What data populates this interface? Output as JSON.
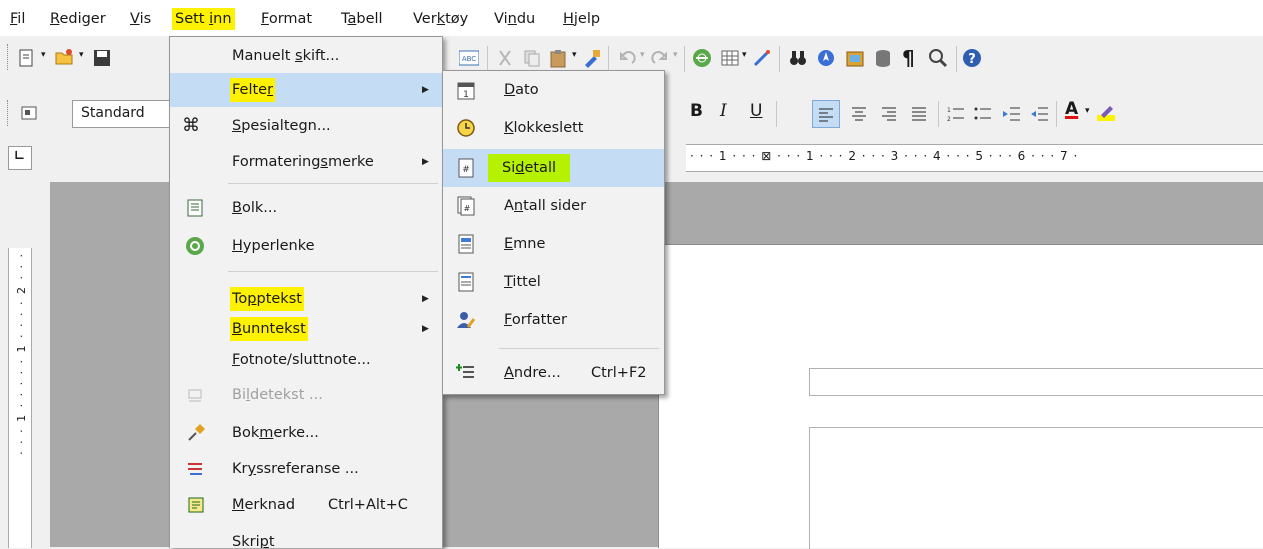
{
  "menubar": {
    "items": [
      {
        "label": "Fil",
        "mn": "F",
        "rest": "il"
      },
      {
        "label": "Rediger",
        "mn": "R",
        "rest": "ediger"
      },
      {
        "label": "Vis",
        "mn": "V",
        "rest": "is"
      },
      {
        "label": "Sett inn",
        "pre": "Sett ",
        "mn": "i",
        "rest": "nn"
      },
      {
        "label": "Format",
        "mn": "F",
        "rest": "ormat"
      },
      {
        "label": "Tabell",
        "pre": "T",
        "mn": "a",
        "rest": "bell"
      },
      {
        "label": "Verktøy",
        "pre": "Ver",
        "mn": "k",
        "rest": "tøy"
      },
      {
        "label": "Vindu",
        "pre": "Vi",
        "mn": "n",
        "rest": "du"
      },
      {
        "label": "Hjelp",
        "mn": "H",
        "rest": "jelp"
      }
    ],
    "highlight_color": "#fff200"
  },
  "formatting": {
    "paragraph_style": "Standard",
    "bold": "B",
    "italic": "I",
    "underline": "U"
  },
  "ruler": {
    "ticks": "· · · 1 · · · ⊠ · · · 1 · · · 2 · · · 3 · · · 4 · · · 5 · · · 6 · · · 7 ·",
    "vticks": "· · · 1 · · · · · 1 · · · · 2 · · ·"
  },
  "sett_inn_menu": {
    "items": [
      {
        "pre": "Manuelt ",
        "mn": "s",
        "rest": "kift..."
      },
      {
        "pre": "Felte",
        "mn": "r",
        "rest": "",
        "submenu": true,
        "hl": "yellow"
      },
      {
        "pre": "",
        "mn": "S",
        "rest": "pesialtegn...",
        "icon": "special-char-icon"
      },
      {
        "pre": "Formatering",
        "mn": "s",
        "rest": "merke",
        "submenu": true
      },
      {
        "pre": "",
        "mn": "B",
        "rest": "olk...",
        "icon": "section-icon"
      },
      {
        "pre": "",
        "mn": "H",
        "rest": "yperlenke",
        "icon": "hyperlink-icon"
      },
      {
        "pre": "To",
        "mn": "p",
        "rest": "ptekst",
        "submenu": true,
        "hl": "yellow"
      },
      {
        "pre": "",
        "mn": "B",
        "rest": "unntekst",
        "submenu": true,
        "hl": "yellow"
      },
      {
        "pre": "",
        "mn": "F",
        "rest": "otnote/sluttnote..."
      },
      {
        "pre": "Bi",
        "mn": "l",
        "rest": "detekst ...",
        "disabled": true,
        "icon": "caption-icon"
      },
      {
        "pre": "Bok",
        "mn": "m",
        "rest": "erke...",
        "icon": "bookmark-icon"
      },
      {
        "pre": "Kr",
        "mn": "y",
        "rest": "ssreferanse ...",
        "icon": "cross-reference-icon"
      },
      {
        "pre": "",
        "mn": "M",
        "rest": "erknad",
        "shortcut": "Ctrl+Alt+C",
        "icon": "comment-icon"
      },
      {
        "pre": "Skri",
        "mn": "p",
        "rest": "t"
      }
    ]
  },
  "felter_submenu": {
    "items": [
      {
        "pre": "",
        "mn": "D",
        "rest": "ato",
        "icon": "date-icon"
      },
      {
        "pre": "",
        "mn": "K",
        "rest": "lokkeslett",
        "icon": "clock-icon"
      },
      {
        "pre": "Si",
        "mn": "d",
        "rest": "etall",
        "icon": "page-number-icon",
        "hl": "green"
      },
      {
        "pre": "A",
        "mn": "n",
        "rest": "tall sider",
        "icon": "page-count-icon"
      },
      {
        "pre": "",
        "mn": "E",
        "rest": "mne",
        "icon": "subject-icon"
      },
      {
        "pre": "",
        "mn": "T",
        "rest": "ittel",
        "icon": "title-icon"
      },
      {
        "pre": "",
        "mn": "F",
        "rest": "orfatter",
        "icon": "author-icon"
      },
      {
        "pre": "",
        "mn": "A",
        "rest": "ndre...",
        "shortcut": "Ctrl+F2",
        "icon": "other-fields-icon"
      }
    ]
  },
  "colors": {
    "yellow": "#fff200",
    "green": "#b5f100",
    "selection": "#c5dcf5"
  }
}
